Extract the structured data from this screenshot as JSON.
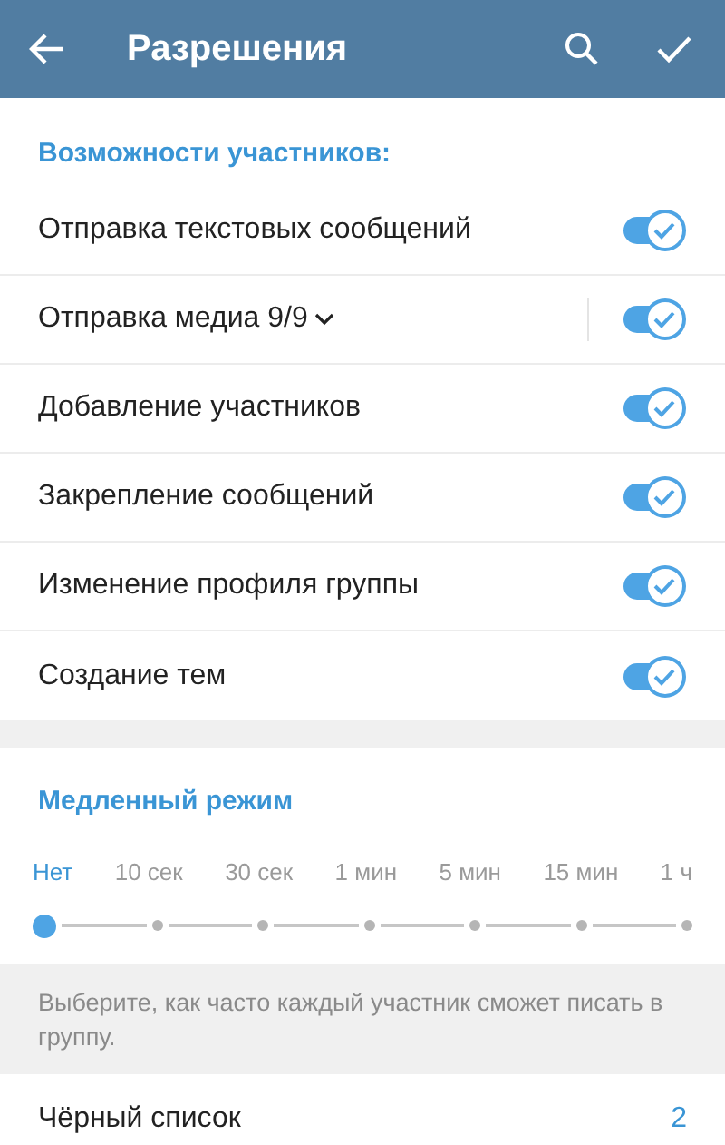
{
  "header": {
    "title": "Разрешения"
  },
  "permissions": {
    "heading": "Возможности участников:",
    "items": [
      {
        "kind": "toggle",
        "label": "Отправка текстовых сообщений",
        "on": true
      },
      {
        "kind": "expandable",
        "label": "Отправка медиа 9/9",
        "on": true,
        "expanded": false
      },
      {
        "kind": "toggle",
        "label": "Добавление участников",
        "on": true
      },
      {
        "kind": "toggle",
        "label": "Закрепление сообщений",
        "on": true
      },
      {
        "kind": "toggle",
        "label": "Изменение профиля группы",
        "on": true
      },
      {
        "kind": "toggle",
        "label": "Создание тем",
        "on": true
      }
    ]
  },
  "slow_mode": {
    "heading": "Медленный режим",
    "options": [
      {
        "label": "Нет",
        "selected": true
      },
      {
        "label": "10 сек",
        "selected": false
      },
      {
        "label": "30 сек",
        "selected": false
      },
      {
        "label": "1 мин",
        "selected": false
      },
      {
        "label": "5 мин",
        "selected": false
      },
      {
        "label": "15 мин",
        "selected": false
      },
      {
        "label": "1 ч",
        "selected": false
      }
    ],
    "hint": "Выберите, как часто каждый участник сможет писать в группу."
  },
  "blacklist": {
    "label": "Чёрный список",
    "count": "2"
  }
}
